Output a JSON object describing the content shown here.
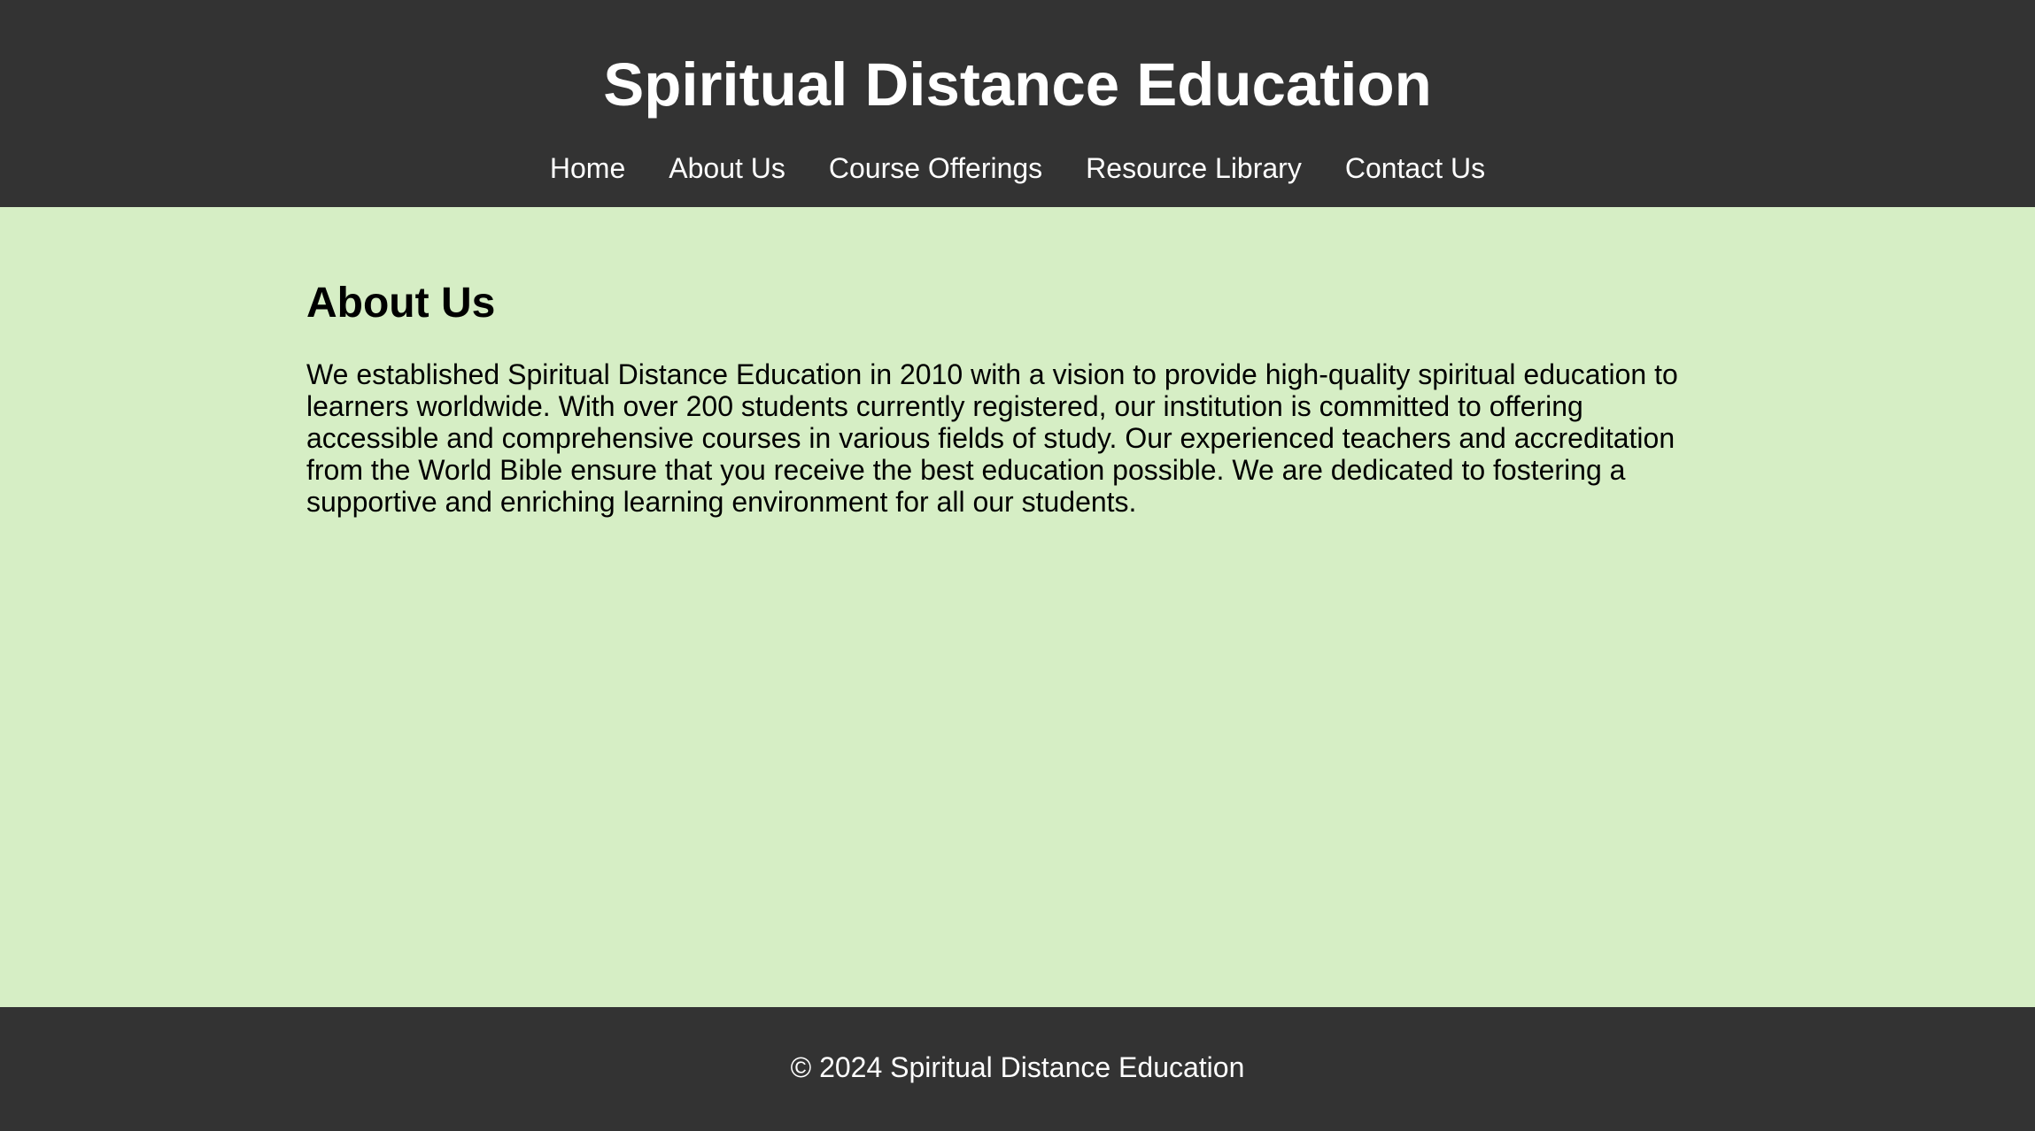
{
  "header": {
    "title": "Spiritual Distance Education",
    "nav": [
      {
        "label": "Home"
      },
      {
        "label": "About Us"
      },
      {
        "label": "Course Offerings"
      },
      {
        "label": "Resource Library"
      },
      {
        "label": "Contact Us"
      }
    ]
  },
  "main": {
    "heading": "About Us",
    "body": "We established Spiritual Distance Education in 2010 with a vision to provide high-quality spiritual education to learners worldwide. With over 200 students currently registered, our institution is committed to offering accessible and comprehensive courses in various fields of study. Our experienced teachers and accreditation from the World Bible ensure that you receive the best education possible. We are dedicated to fostering a supportive and enriching learning environment for all our students."
  },
  "footer": {
    "copyright": "© 2024 Spiritual Distance Education"
  },
  "colors": {
    "header_bg": "#333333",
    "page_bg": "#d6eec5",
    "header_text": "#ffffff",
    "body_text": "#000000"
  }
}
